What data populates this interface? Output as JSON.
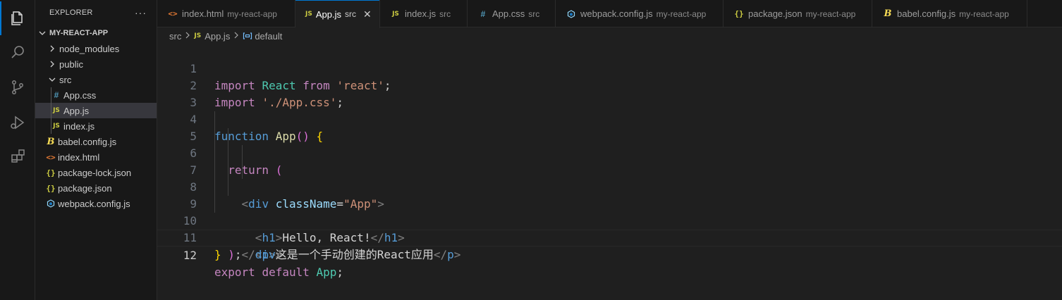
{
  "sidebar": {
    "title": "EXPLORER",
    "more": "···",
    "root": "MY-REACT-APP",
    "items": [
      {
        "label": "node_modules",
        "icon": "chevron-right-icon"
      },
      {
        "label": "public",
        "icon": "chevron-right-icon"
      },
      {
        "label": "src",
        "icon": "chevron-down-icon"
      },
      {
        "label": "App.css",
        "icon": "#"
      },
      {
        "label": "App.js",
        "icon": "JS"
      },
      {
        "label": "index.js",
        "icon": "JS"
      },
      {
        "label": "babel.config.js",
        "icon": "B"
      },
      {
        "label": "index.html",
        "icon": "<>"
      },
      {
        "label": "package-lock.json",
        "icon": "{}"
      },
      {
        "label": "package.json",
        "icon": "{}"
      },
      {
        "label": "webpack.config.js",
        "icon": "webpack-icon"
      }
    ]
  },
  "tabs": [
    {
      "label": "index.html",
      "desc": "my-react-app",
      "icon": "<>"
    },
    {
      "label": "App.js",
      "desc": "src",
      "icon": "JS",
      "close": "✕"
    },
    {
      "label": "index.js",
      "desc": "src",
      "icon": "JS"
    },
    {
      "label": "App.css",
      "desc": "src",
      "icon": "#"
    },
    {
      "label": "webpack.config.js",
      "desc": "my-react-app",
      "icon": "webpack-icon"
    },
    {
      "label": "package.json",
      "desc": "my-react-app",
      "icon": "{}"
    },
    {
      "label": "babel.config.js",
      "desc": "my-react-app",
      "icon": "B"
    }
  ],
  "breadcrumb": {
    "folder": "src",
    "file": "App.js",
    "symbol": "default",
    "file_icon": "JS"
  },
  "editor": {
    "line_numbers": [
      "1",
      "2",
      "3",
      "4",
      "5",
      "6",
      "7",
      "8",
      "9",
      "10",
      "11",
      "12"
    ],
    "current_line": "12",
    "lines": [
      "import React from 'react';",
      "import './App.css';",
      "",
      "function App() {",
      "  return (",
      "    <div className=\"App\">",
      "      <h1>Hello, React!</h1>",
      "      <p>这是一个手动创建的React应用</p>",
      "    </div>",
      "  );",
      "}",
      "export default App;"
    ]
  },
  "colors": {
    "accent": "#0078d4",
    "background": "#1f1f1f",
    "sidebar": "#181818"
  }
}
